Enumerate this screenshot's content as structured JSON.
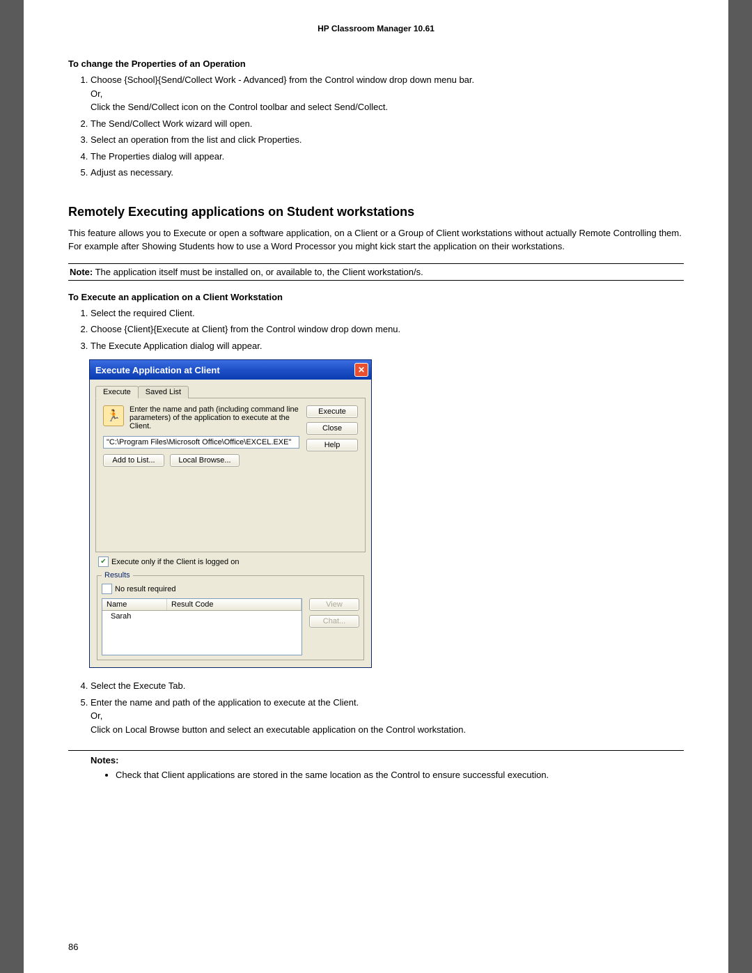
{
  "doc_header": "HP Classroom Manager 10.61",
  "section1_title": "To change the Properties of an Operation",
  "section1_steps": [
    "Choose {School}{Send/Collect Work - Advanced} from the Control window drop down menu bar.\nOr,\nClick the Send/Collect icon on the Control toolbar and select Send/Collect.",
    "The Send/Collect Work wizard will open.",
    "Select an operation from the list and click Properties.",
    "The Properties dialog will appear.",
    "Adjust as necessary."
  ],
  "h2_title": "Remotely Executing applications on Student workstations",
  "h2_para": "This feature allows you to Execute or open a software application, on a Client or a Group of Client workstations without actually Remote Controlling them. For example after Showing Students how to use a Word Processor you might kick start the application on their workstations.",
  "note_label": "Note:",
  "note_text": "The application itself must be installed on, or available to, the Client workstation/s.",
  "section2_title": "To Execute an application on a Client Workstation",
  "section2_steps_before": [
    "Select the required Client.",
    "Choose {Client}{Execute at Client} from the Control window drop down menu.",
    "The Execute Application dialog will appear."
  ],
  "section2_steps_after": [
    "Select the Execute Tab.",
    "Enter the name and path of the application to execute at the Client.\nOr,\nClick on Local Browse button and select an executable application on the Control workstation."
  ],
  "notes_label": "Notes:",
  "notes_items": [
    "Check that Client applications are stored in the same location as the Control to ensure successful execution."
  ],
  "page_number": "86",
  "dialog": {
    "title": "Execute Application at Client",
    "tabs": {
      "execute": "Execute",
      "saved": "Saved List"
    },
    "hint": "Enter the name and path (including command line parameters) of the application to execute at the Client.",
    "path_value": "\"C:\\Program Files\\Microsoft Office\\Office\\EXCEL.EXE\"",
    "btn_add": "Add to List...",
    "btn_browse": "Local Browse...",
    "btn_execute": "Execute",
    "btn_close": "Close",
    "btn_help": "Help",
    "cb_logged_on": "Execute only if the Client is logged on",
    "results_legend": "Results",
    "cb_no_result": "No result required",
    "col_name": "Name",
    "col_code": "Result Code",
    "row_name": "Sarah",
    "btn_view": "View",
    "btn_chat": "Chat..."
  }
}
